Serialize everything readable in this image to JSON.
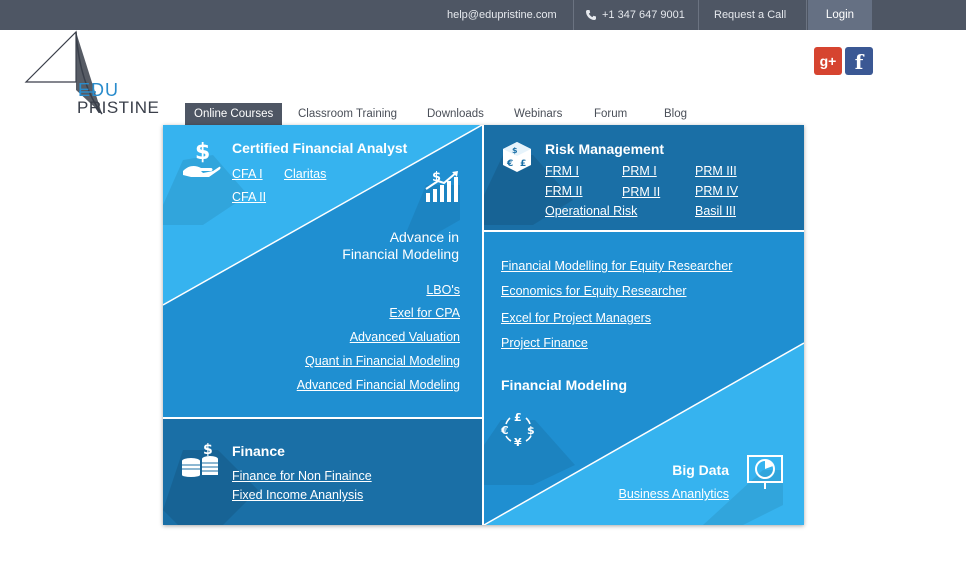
{
  "topbar": {
    "email": "help@edupristine.com",
    "phone": "+1 347 647 9001",
    "request_call": "Request a Call",
    "login": "Login"
  },
  "logo": {
    "line1": "EDU",
    "line2": "PRISTINE"
  },
  "social": {
    "gplus": "g+",
    "facebook": "f"
  },
  "nav": {
    "items": [
      "Online Courses",
      "Classroom Training",
      "Downloads",
      "Webinars",
      "Forum",
      "Blog"
    ],
    "active_index": 0
  },
  "menu": {
    "cfa": {
      "title": "Certified Financial Analyst",
      "links": [
        "CFA I",
        "Claritas",
        "CFA II"
      ]
    },
    "afm": {
      "title_line1": "Advance in",
      "title_line2": "Financial Modeling",
      "links": [
        "LBO's",
        "Exel for CPA",
        "Advanced Valuation",
        "Quant in Financial Modeling",
        "Advanced Financial Modeling"
      ]
    },
    "risk": {
      "title": "Risk Management",
      "links": [
        "FRM I",
        "PRM I",
        "PRM III",
        "FRM II",
        "PRM II",
        "PRM IV",
        "Operational Risk",
        "Basil III"
      ]
    },
    "fm": {
      "links": [
        "Financial Modelling for Equity Researcher",
        "Economics for Equity Researcher",
        "Excel for Project Managers",
        "Project Finance"
      ],
      "title": "Financial Modeling"
    },
    "finance": {
      "title": "Finance",
      "links": [
        "Finance for Non Finaince",
        "Fixed Income Ananlysis"
      ]
    },
    "bigdata": {
      "title": "Big Data",
      "links": [
        "Business Ananlytics"
      ]
    }
  },
  "colors": {
    "topbar": "#4e5664",
    "light_blue": "#36b3ef",
    "mid_blue": "#1f8fd1",
    "dark_blue": "#1a6fa6",
    "gplus": "#d64430",
    "facebook": "#3b5894"
  }
}
